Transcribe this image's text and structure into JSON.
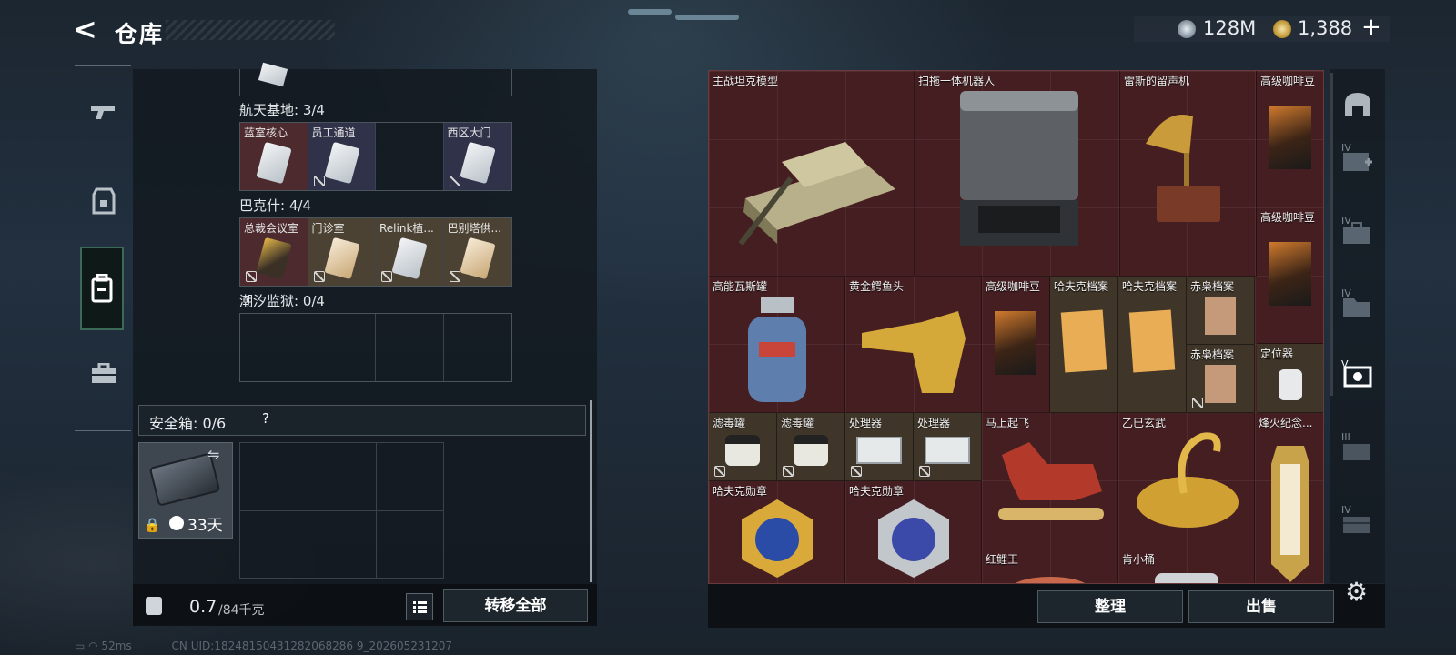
{
  "header": {
    "back_glyph": "<",
    "title": "仓库",
    "currency1": "128M",
    "currency2": "1,388",
    "currency_plus": "+"
  },
  "left_nav": [
    "gun-icon",
    "armor-icon",
    "backpack-icon",
    "toolbox-icon"
  ],
  "left_panel": {
    "sections": [
      {
        "label": "航天基地: 3/4",
        "slots": [
          {
            "label": "蓝室核心",
            "style": "red",
            "locked": false
          },
          {
            "label": "员工通道",
            "style": "blue",
            "locked": true
          },
          {
            "label": "",
            "style": "empty",
            "locked": false
          },
          {
            "label": "西区大门",
            "style": "blue",
            "locked": true
          }
        ]
      },
      {
        "label": "巴克什: 4/4",
        "slots": [
          {
            "label": "总裁会议室",
            "style": "red",
            "locked": true
          },
          {
            "label": "门诊室",
            "style": "tan",
            "locked": true
          },
          {
            "label": "Relink植...",
            "style": "tan",
            "locked": true
          },
          {
            "label": "巴别塔供...",
            "style": "tan",
            "locked": true
          }
        ]
      },
      {
        "label": "潮汐监狱: 0/4",
        "slots": []
      }
    ],
    "safe_box_label": "安全箱: 0/6",
    "safe_box_help": "?",
    "safe_days": "33天",
    "weight_current": "0.7",
    "weight_max": "/84千克",
    "transfer_all": "转移全部"
  },
  "grid_items": [
    {
      "label": "主战坦克模型"
    },
    {
      "label": "扫拖一体机器人"
    },
    {
      "label": "雷斯的留声机"
    },
    {
      "label": "高级咖啡豆"
    },
    {
      "label": "高级咖啡豆"
    },
    {
      "label": "高能瓦斯罐"
    },
    {
      "label": "黄金鳄鱼头"
    },
    {
      "label": "高级咖啡豆"
    },
    {
      "label": "哈夫克档案"
    },
    {
      "label": "哈夫克档案"
    },
    {
      "label": "赤枭档案"
    },
    {
      "label": "赤枭档案"
    },
    {
      "label": "定位器"
    },
    {
      "label": "滤毒罐"
    },
    {
      "label": "滤毒罐"
    },
    {
      "label": "处理器"
    },
    {
      "label": "处理器"
    },
    {
      "label": "马上起飞"
    },
    {
      "label": "乙巳玄武"
    },
    {
      "label": "烽火纪念..."
    },
    {
      "label": "哈夫克勋章"
    },
    {
      "label": "哈夫克勋章"
    },
    {
      "label": "红鲤王"
    },
    {
      "label": "肯小桶"
    }
  ],
  "actions": {
    "organize": "整理",
    "sell": "出售"
  },
  "right_nav": [
    {
      "level": "",
      "icon": "helmet-icon"
    },
    {
      "level": "IV",
      "icon": "medkit-icon"
    },
    {
      "level": "IV",
      "icon": "case-icon"
    },
    {
      "level": "IV",
      "icon": "folder-icon"
    },
    {
      "level": "V",
      "icon": "device-icon"
    },
    {
      "level": "III",
      "icon": "box-icon"
    },
    {
      "level": "IV",
      "icon": "crate-icon"
    }
  ],
  "status_bar": {
    "ping": "52ms",
    "uid": "CN UID:18248150431282068286 9_202605231207"
  }
}
